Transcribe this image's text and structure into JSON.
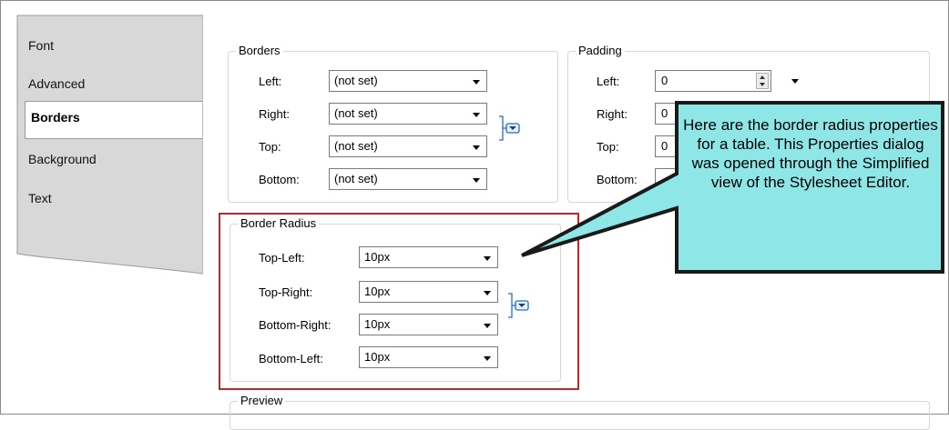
{
  "tabs": {
    "font": "Font",
    "advanced": "Advanced",
    "borders": "Borders",
    "background": "Background",
    "text": "Text"
  },
  "borders": {
    "title": "Borders",
    "rows": [
      {
        "label": "Left:",
        "value": "(not set)"
      },
      {
        "label": "Right:",
        "value": "(not set)"
      },
      {
        "label": "Top:",
        "value": "(not set)"
      },
      {
        "label": "Bottom:",
        "value": "(not set)"
      }
    ]
  },
  "padding": {
    "title": "Padding",
    "rows": [
      {
        "label": "Left:",
        "value": "0"
      },
      {
        "label": "Right:",
        "value": "0"
      },
      {
        "label": "Top:",
        "value": "0"
      },
      {
        "label": "Bottom:",
        "value": ""
      }
    ]
  },
  "border_radius": {
    "title": "Border Radius",
    "rows": [
      {
        "label": "Top-Left:",
        "value": "10px"
      },
      {
        "label": "Top-Right:",
        "value": "10px"
      },
      {
        "label": "Bottom-Right:",
        "value": "10px"
      },
      {
        "label": "Bottom-Left:",
        "value": "10px"
      }
    ]
  },
  "preview": {
    "title": "Preview"
  },
  "callout": {
    "text": "Here are the border radius properties for a table. This Properties dialog was opened through the Simplified view of the Stylesheet Editor."
  },
  "colors": {
    "callout_fill": "#8fe6e6",
    "highlight": "#c0272d",
    "tab_pane": "#d8d8d8"
  },
  "icons": {
    "link": "expand-link-icon",
    "dropdown": "chevron-down-icon",
    "spinner": "spinner-arrows-icon"
  }
}
